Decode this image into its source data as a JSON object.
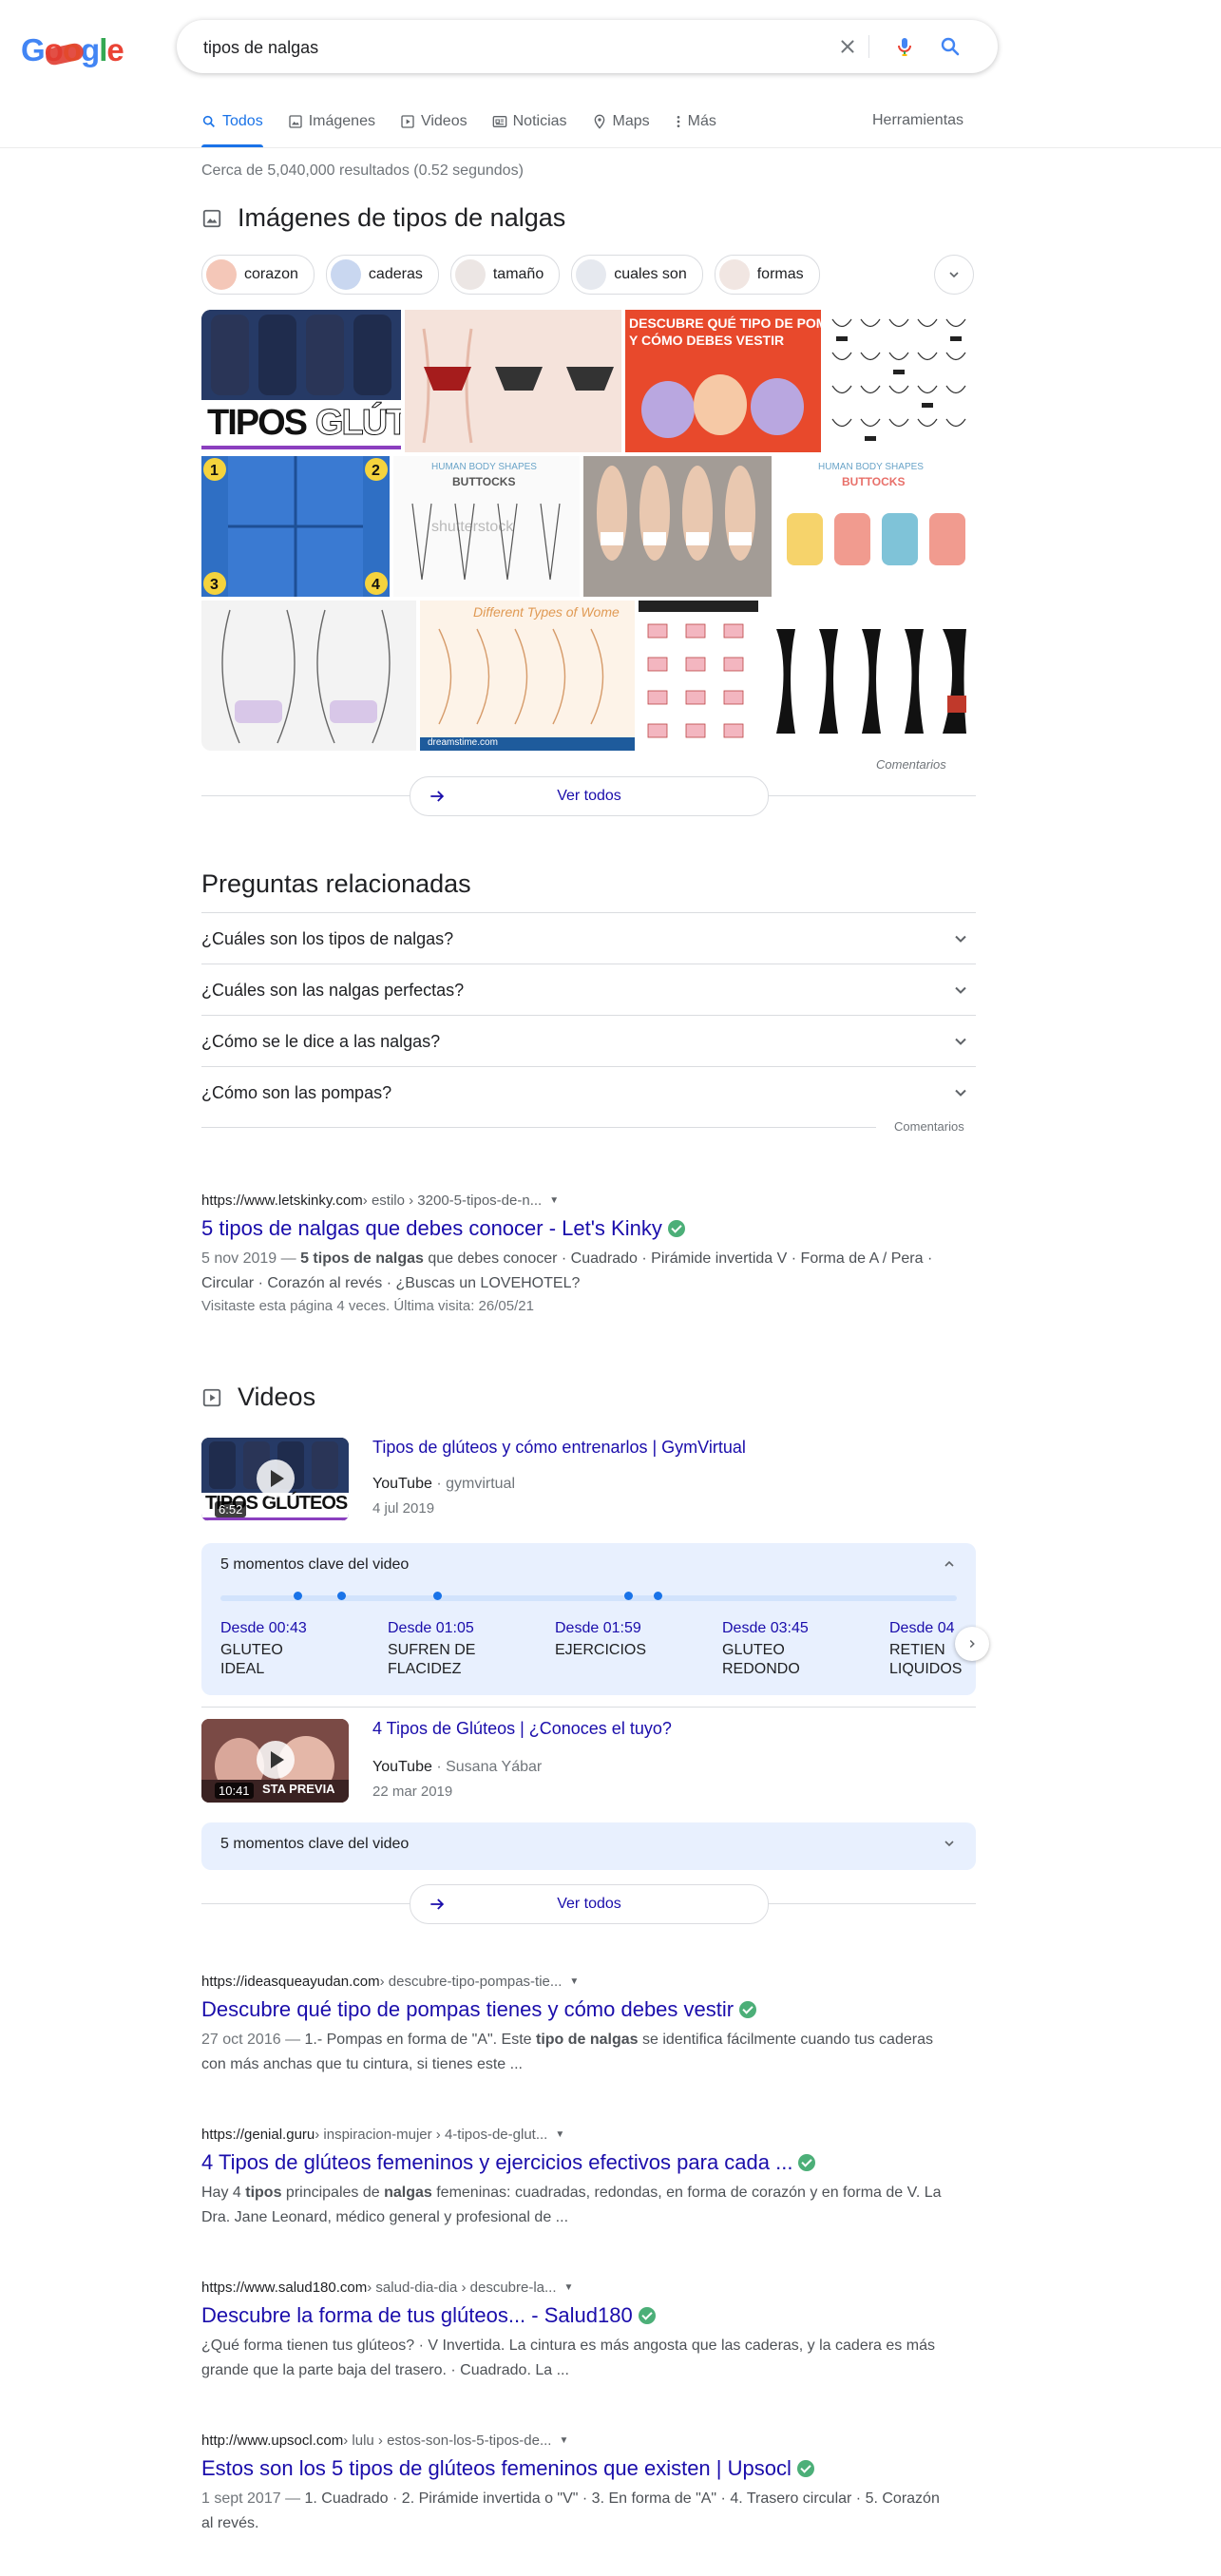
{
  "logo": {
    "letters": [
      "G",
      "o",
      "o",
      "g",
      "l",
      "e"
    ]
  },
  "search": {
    "query": "tipos de nalgas",
    "clear_icon": "close-icon",
    "voice_icon": "mic-icon",
    "search_icon": "search-icon"
  },
  "tabs": [
    {
      "label": "Todos",
      "icon": "search-icon",
      "active": true
    },
    {
      "label": "Imágenes",
      "icon": "image-icon"
    },
    {
      "label": "Videos",
      "icon": "video-icon"
    },
    {
      "label": "Noticias",
      "icon": "news-icon"
    },
    {
      "label": "Maps",
      "icon": "pin-icon"
    },
    {
      "label": "Más",
      "icon": "more-vert-icon"
    }
  ],
  "tools_label": "Herramientas",
  "stats": "Cerca de 5,040,000 resultados (0.52 segundos)",
  "images": {
    "title": "Imágenes de tipos de nalgas",
    "chips": [
      "corazon",
      "caderas",
      "tamaño",
      "cuales son",
      "formas"
    ],
    "tile_texts": {
      "t1": "TIPOS",
      "t1b": "GLÚT",
      "t3a": "DESCUBRE QUÉ TIPO DE POMPAS TI",
      "t3b": "Y CÓMO DEBES VESTIR",
      "t6a": "HUMAN BODY SHAPES",
      "t6b": "BUTTOCKS",
      "t6c": "shutterstock",
      "t8a": "HUMAN BODY SHAPES",
      "t8b": "BUTTOCKS",
      "t10a": "Different Types of Wome",
      "t10b": "dreamstime.com"
    },
    "comments": "Comentarios",
    "see_all": "Ver todos"
  },
  "paa": {
    "title": "Preguntas relacionadas",
    "questions": [
      "¿Cuáles son los tipos de nalgas?",
      "¿Cuáles son las nalgas perfectas?",
      "¿Cómo se le dice a las nalgas?",
      "¿Cómo son las pompas?"
    ],
    "comments": "Comentarios"
  },
  "result1": {
    "domain": "https://www.letskinky.com",
    "path": " › estilo › 3200-5-tipos-de-n...",
    "title": "5 tipos de nalgas que debes conocer - Let's Kinky",
    "date": "5 nov 2019 — ",
    "snip_bold1": "5 tipos de nalgas",
    "snip_rest": " que debes conocer · Cuadrado · Pirámide invertida V · Forma de A / Pera · Circular · Corazón al revés · ¿Buscas un LOVEHOTEL?",
    "visited": "Visitaste esta página 4 veces. Última visita: 26/05/21"
  },
  "videos": {
    "title": "Videos",
    "v1": {
      "title": "Tipos de glúteos y cómo entrenarlos | GymVirtual",
      "source": "YouTube",
      "channel": " · gymvirtual",
      "date": "4 jul 2019",
      "duration": "6:52",
      "thumb_text": "TIPOS GLÚTEOS"
    },
    "moments1": {
      "header": "5 momentos clave del video",
      "items": [
        {
          "time": "Desde 00:43",
          "desc": "GLUTEO IDEAL"
        },
        {
          "time": "Desde 01:05",
          "desc": "SUFREN DE FLACIDEZ"
        },
        {
          "time": "Desde 01:59",
          "desc": "EJERCICIOS"
        },
        {
          "time": "Desde 03:45",
          "desc": "GLUTEO REDONDO"
        },
        {
          "time": "Desde 04",
          "desc": "RETIEN LIQUIDOS"
        }
      ]
    },
    "v2": {
      "title": "4 Tipos de Glúteos | ¿Conoces el tuyo?",
      "source": "YouTube",
      "channel": " · Susana Yábar",
      "date": "22 mar 2019",
      "duration": "10:41",
      "thumb_text": "STA PREVIA"
    },
    "moments2": {
      "header": "5 momentos clave del video"
    },
    "see_all": "Ver todos"
  },
  "result2": {
    "domain": "https://ideasqueayudan.com",
    "path": " › descubre-tipo-pompas-tie...",
    "title": "Descubre qué tipo de pompas tienes y cómo debes vestir",
    "date": "27 oct 2016 — ",
    "snip_a": "1.- Pompas en forma de \"A\". Este ",
    "snip_bold": "tipo de nalgas",
    "snip_b": " se identifica fácilmente cuando tus caderas con más anchas que tu cintura, si tienes este ..."
  },
  "result3": {
    "domain": "https://genial.guru",
    "path": " › inspiracion-mujer › 4-tipos-de-glut...",
    "title": "4 Tipos de glúteos femeninos y ejercicios efectivos para cada ...",
    "snip_a": "Hay 4 ",
    "snip_bold1": "tipos",
    "snip_b": " principales de ",
    "snip_bold2": "nalgas",
    "snip_c": " femeninas: cuadradas, redondas, en forma de corazón y en forma de V. La Dra. Jane Leonard, médico general y profesional de ..."
  },
  "result4": {
    "domain": "https://www.salud180.com",
    "path": " › salud-dia-dia › descubre-la...",
    "title": "Descubre la forma de tus glúteos... - Salud180",
    "snip": "¿Qué forma tienen tus glúteos? · V Invertida. La cintura es más angosta que las caderas, y la cadera es más grande que la parte baja del trasero. · Cuadrado. La ..."
  },
  "result5": {
    "domain": "http://www.upsocl.com",
    "path": " › lulu › estos-son-los-5-tipos-de...",
    "title": "Estos son los 5 tipos de glúteos femeninos que existen | Upsocl",
    "date": "1 sept 2017 — ",
    "snip": "1. Cuadrado · 2. Pirámide invertida o \"V\" · 3. En forma de \"A\" · 4. Trasero circular · 5. Corazón al revés."
  }
}
